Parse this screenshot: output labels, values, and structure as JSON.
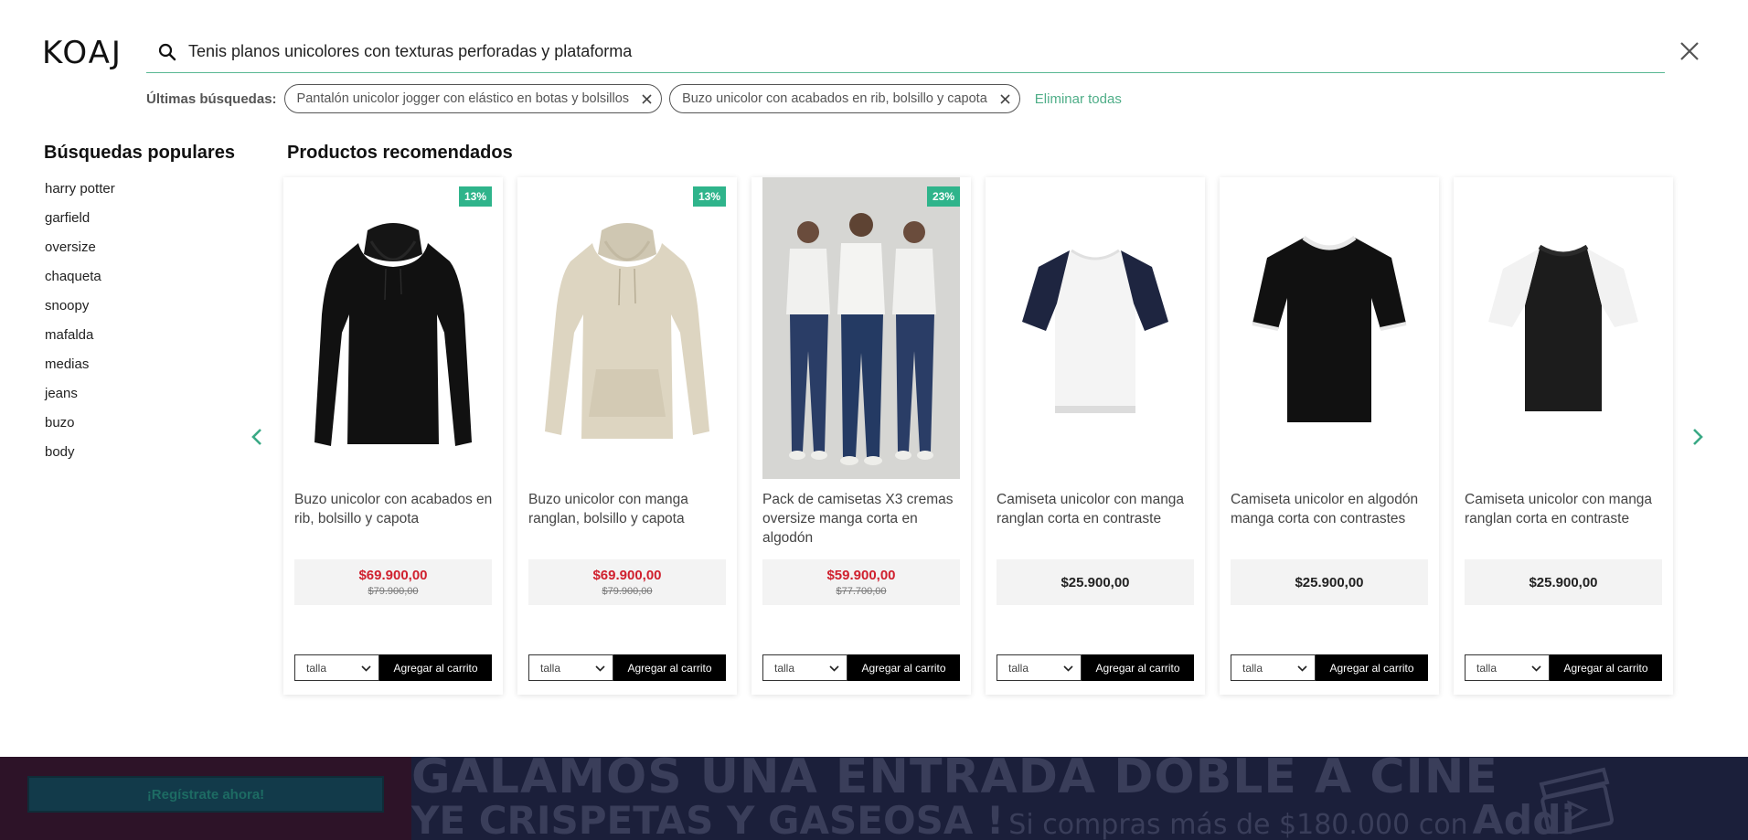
{
  "brand": {
    "logo": "KOAJ"
  },
  "search": {
    "value": "Tenis planos unicolores con texturas perforadas y plataforma",
    "recent_label": "Últimas búsquedas:",
    "recent": [
      "Pantalón unicolor jogger con elástico en botas y bolsillos",
      "Buzo unicolor con acabados en rib, bolsillo y capota"
    ],
    "clear_all": "Eliminar todas"
  },
  "popular": {
    "title": "Búsquedas populares",
    "items": [
      "harry potter",
      "garfield",
      "oversize",
      "chaqueta",
      "snoopy",
      "mafalda",
      "medias",
      "jeans",
      "buzo",
      "body"
    ]
  },
  "products": {
    "title": "Productos recomendados",
    "size_label": "talla",
    "add_label": "Agregar al carrito",
    "items": [
      {
        "badge": "13%",
        "name": "Buzo unicolor con acabados en rib, bolsillo y capota",
        "price": "$69.900,00",
        "old_price": "$79.900,00"
      },
      {
        "badge": "13%",
        "name": "Buzo unicolor con manga ranglan, bolsillo y capota",
        "price": "$69.900,00",
        "old_price": "$79.900,00"
      },
      {
        "badge": "23%",
        "name": "Pack de camisetas X3 cremas oversize manga corta en algodón",
        "price": "$59.900,00",
        "old_price": "$77.700,00"
      },
      {
        "badge": "",
        "name": "Camiseta unicolor con manga ranglan corta en contraste",
        "price": "$25.900,00",
        "old_price": ""
      },
      {
        "badge": "",
        "name": "Camiseta unicolor en algodón manga corta con contrastes",
        "price": "$25.900,00",
        "old_price": ""
      },
      {
        "badge": "",
        "name": "Camiseta unicolor con manga ranglan corta en contraste",
        "price": "$25.900,00",
        "old_price": ""
      }
    ]
  },
  "banner": {
    "register": "¡Regístrate ahora!",
    "line1": "GALAMOS UNA ENTRADA DOBLE A CINE",
    "line2_big": "YE CRISPETAS Y GASEOSA !",
    "line2_small": "Si compras más de $180.000 con",
    "line2_brand": "Addi"
  },
  "colors": {
    "accent": "#59b893",
    "sale": "#d0202e",
    "badge": "#2fb48b"
  }
}
